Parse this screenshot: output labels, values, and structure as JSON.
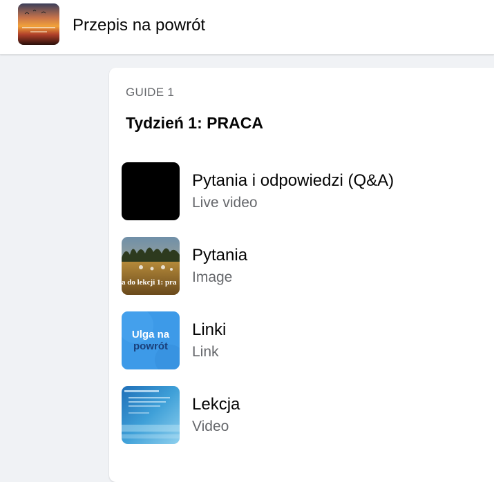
{
  "header": {
    "group_name": "Przepis na powrót",
    "avatar_icon": "group-cover-sunset-image"
  },
  "guide": {
    "label": "GUIDE 1",
    "title": "Tydzień 1: PRACA",
    "items": [
      {
        "title": "Pytania i odpowiedzi (Q&A)",
        "type": "Live video",
        "thumb_icon": "black-video-thumbnail"
      },
      {
        "title": "Pytania",
        "type": "Image",
        "thumb_icon": "field-landscape-thumbnail",
        "thumb_text": "a do lekcji 1: pra"
      },
      {
        "title": "Linki",
        "type": "Link",
        "thumb_icon": "ulga-na-powrot-logo-thumbnail",
        "thumb_text_line1": "Ulga na",
        "thumb_text_line2": "powrót"
      },
      {
        "title": "Lekcja",
        "type": "Video",
        "thumb_icon": "blue-presentation-thumbnail"
      }
    ]
  },
  "colors": {
    "page_bg": "#f0f2f5",
    "card_bg": "#ffffff",
    "secondary_text": "#65676b",
    "link_thumb_blue": "#3d9ae8"
  }
}
